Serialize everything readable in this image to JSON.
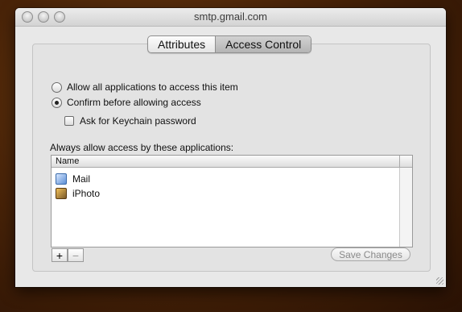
{
  "window": {
    "title": "smtp.gmail.com"
  },
  "tabs": [
    {
      "label": "Attributes"
    },
    {
      "label": "Access Control"
    }
  ],
  "access": {
    "allow_all_label": "Allow all applications to access this item",
    "confirm_label": "Confirm before allowing access",
    "ask_keychain_label": "Ask for Keychain password",
    "selected_option": "confirm",
    "ask_keychain_checked": false
  },
  "apps_section": {
    "heading": "Always allow access by these applications:",
    "column_header": "Name",
    "items": [
      {
        "name": "Mail",
        "icon": "mail-icon"
      },
      {
        "name": "iPhoto",
        "icon": "iphoto-icon"
      }
    ]
  },
  "buttons": {
    "add": "+",
    "remove": "−",
    "save": "Save Changes"
  }
}
